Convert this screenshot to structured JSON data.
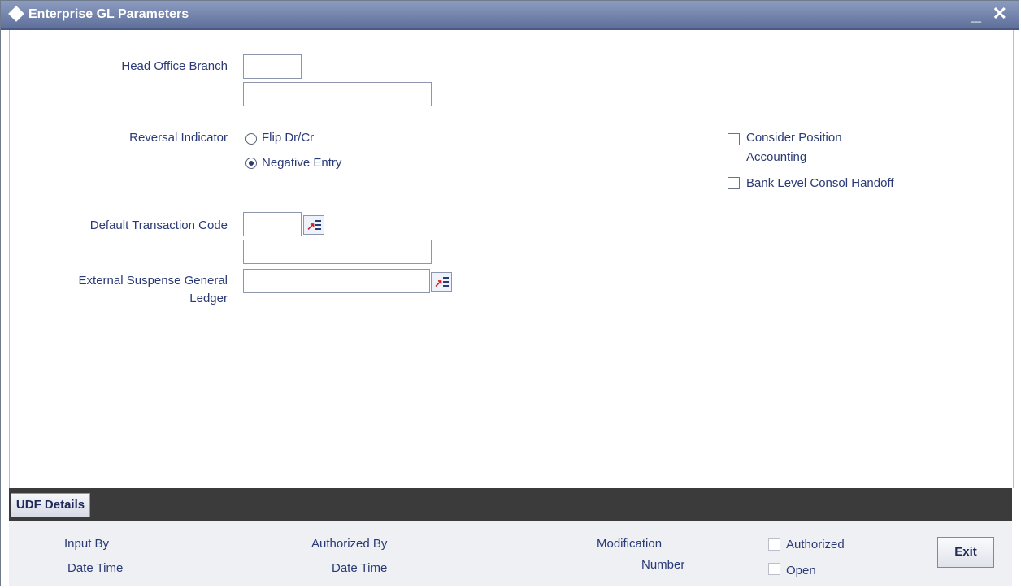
{
  "window": {
    "title": "Enterprise GL Parameters",
    "minimize_glyph": "_",
    "close_glyph": "✕"
  },
  "form": {
    "head_office_branch": {
      "label": "Head Office Branch",
      "value": "",
      "description": ""
    },
    "reversal_indicator": {
      "label": "Reversal Indicator",
      "options": [
        {
          "label": "Flip Dr/Cr",
          "selected": false
        },
        {
          "label": "Negative Entry",
          "selected": true
        }
      ]
    },
    "default_transaction_code": {
      "label": "Default Transaction Code",
      "value": "",
      "description": ""
    },
    "external_suspense_gl": {
      "label_line1": "External Suspense General",
      "label_line2": "Ledger",
      "value": ""
    },
    "consider_position_accounting": {
      "label_line1": "Consider Position",
      "label_line2": "Accounting",
      "checked": false
    },
    "bank_level_consol_handoff": {
      "label": "Bank Level Consol Handoff",
      "checked": false
    }
  },
  "udf": {
    "button_label": "UDF Details"
  },
  "footer": {
    "input_by": "Input By",
    "input_date_time": "Date Time",
    "authorized_by": "Authorized By",
    "authorized_date_time": "Date Time",
    "modification_line1": "Modification",
    "modification_line2": "Number",
    "authorized_label": "Authorized",
    "open_label": "Open",
    "exit_label": "Exit"
  },
  "icons": {
    "lov_icon": "list-of-values-icon",
    "title_icon": "diamond-icon"
  }
}
